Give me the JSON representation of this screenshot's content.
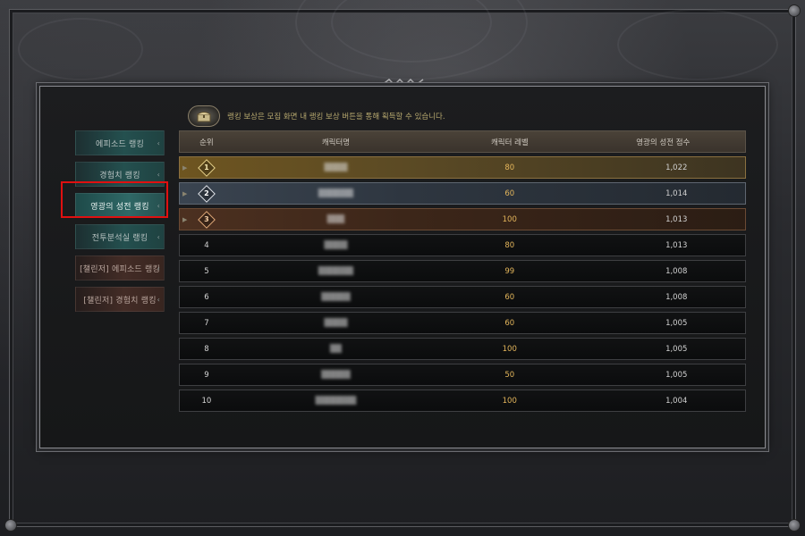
{
  "info_text": "랭킹 보상은 모집 화면 내 랭킹 보상 버튼을 통해 획득할 수 있습니다.",
  "sidebar": {
    "items": [
      {
        "label": "에피소드 랭킹",
        "style": "teal"
      },
      {
        "label": "경험치 랭킹",
        "style": "teal"
      },
      {
        "label": "영광의 성전 랭킹",
        "style": "active"
      },
      {
        "label": "전투분석실 랭킹",
        "style": "teal"
      },
      {
        "label": "[챌린저] 에피소드 랭킹",
        "style": "brown"
      },
      {
        "label": "[챌린저] 경험치 랭킹",
        "style": "brown"
      }
    ],
    "selected_index": 2
  },
  "table": {
    "headers": {
      "rank": "순위",
      "name": "캐릭터명",
      "level": "캐릭터 레벨",
      "score": "영광의 성전 점수"
    },
    "rows": [
      {
        "rank": "1",
        "name": "▒▒▒▒",
        "level": "80",
        "score": "1,022",
        "tier": "gold"
      },
      {
        "rank": "2",
        "name": "▒▒▒▒▒▒",
        "level": "60",
        "score": "1,014",
        "tier": "silver"
      },
      {
        "rank": "3",
        "name": "▒▒▒",
        "level": "100",
        "score": "1,013",
        "tier": "bronze"
      },
      {
        "rank": "4",
        "name": "▒▒▒▒",
        "level": "80",
        "score": "1,013",
        "tier": ""
      },
      {
        "rank": "5",
        "name": "▒▒▒▒▒▒",
        "level": "99",
        "score": "1,008",
        "tier": ""
      },
      {
        "rank": "6",
        "name": "▒▒▒▒▒",
        "level": "60",
        "score": "1,008",
        "tier": ""
      },
      {
        "rank": "7",
        "name": "▒▒▒▒",
        "level": "60",
        "score": "1,005",
        "tier": ""
      },
      {
        "rank": "8",
        "name": "▒▒",
        "level": "100",
        "score": "1,005",
        "tier": ""
      },
      {
        "rank": "9",
        "name": "▒▒▒▒▒",
        "level": "50",
        "score": "1,005",
        "tier": ""
      },
      {
        "rank": "10",
        "name": "▒▒▒▒▒▒▒",
        "level": "100",
        "score": "1,004",
        "tier": ""
      }
    ]
  },
  "colors": {
    "highlight": "#e01010",
    "level_text": "#e3b55b",
    "info_text": "#b7a86e"
  },
  "icons": {
    "info": "treasure-chest-icon",
    "row_marker": "triangle-right-icon",
    "sidebar_arrow": "chevron-left-icon"
  }
}
